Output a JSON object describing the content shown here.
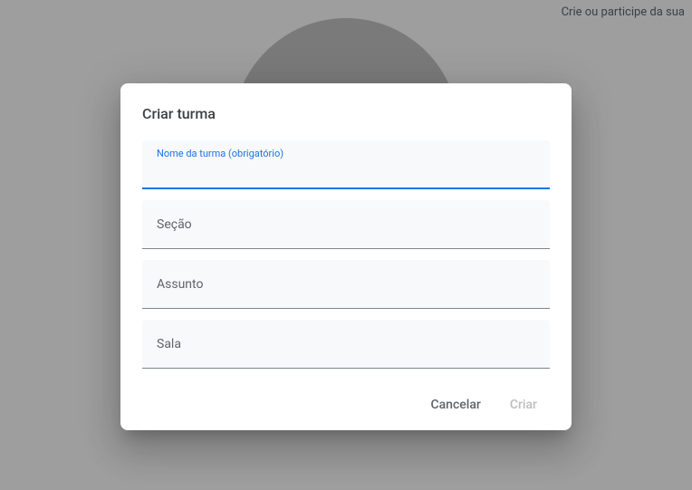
{
  "header": {
    "prompt": "Crie ou participe da sua"
  },
  "dialog": {
    "title": "Criar turma",
    "fields": {
      "class_name": {
        "label": "Nome da turma (obrigatório)",
        "value": ""
      },
      "section": {
        "label": "Seção",
        "value": ""
      },
      "subject": {
        "label": "Assunto",
        "value": ""
      },
      "room": {
        "label": "Sala",
        "value": ""
      }
    },
    "actions": {
      "cancel": "Cancelar",
      "create": "Criar"
    }
  }
}
